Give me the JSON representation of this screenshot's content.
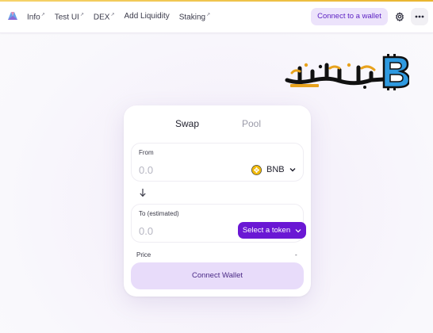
{
  "colors": {
    "accent": "#6a17d4",
    "accent_soft": "#ece3fb",
    "top_stripe": "#e9b52f",
    "bnb": "#f0b90b"
  },
  "header": {
    "logo_icon": "bunny-logo-icon",
    "nav": [
      {
        "label": "Info",
        "external": true,
        "icon": "external-link-icon",
        "mark": "↗"
      },
      {
        "label": "Test UI",
        "external": true,
        "icon": "external-link-icon",
        "mark": "↗"
      },
      {
        "label": "DEX",
        "external": true,
        "icon": "external-link-icon",
        "mark": "↗"
      },
      {
        "label": "Add Liquidity",
        "external": false
      },
      {
        "label": "Staking",
        "external": true,
        "icon": "external-link-icon",
        "mark": "↗"
      }
    ],
    "connect_label": "Connect to a wallet",
    "settings_icon": "gear-icon",
    "more_icon": "more-dots-icon"
  },
  "watermark": {
    "icon": "bitcoin-logo-icon"
  },
  "swap": {
    "tabs": {
      "swap": "Swap",
      "pool": "Pool"
    },
    "from": {
      "label": "From",
      "placeholder": "0.0",
      "token": "BNB",
      "token_icon": "bnb-token-icon"
    },
    "switch_icon": "arrow-down-icon",
    "to": {
      "label": "To (estimated)",
      "placeholder": "0.0",
      "select_label": "Select a token"
    },
    "price_label": "Price",
    "price_value": "-",
    "connect_label": "Connect Wallet"
  }
}
